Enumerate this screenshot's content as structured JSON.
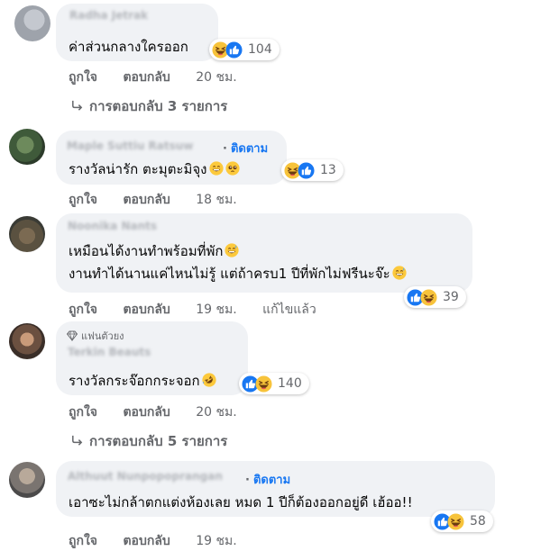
{
  "follow_label": "ติดตาม",
  "like_label": "ถูกใจ",
  "reply_label": "ตอบกลับ",
  "comments": [
    {
      "name": "Radha Jetrak",
      "text": "ค่าส่วนกลางใครออก",
      "reaction_count": "104",
      "time": "20 ชม.",
      "replies": "การตอบกลับ 3 รายการ"
    },
    {
      "name": "Maple Suttiu Ratsuw",
      "text": "รางวัลน่ารัก ตะมุตะมิจุง",
      "reaction_count": "13",
      "time": "18 ชม."
    },
    {
      "name": "Noonika Nants",
      "text_line1": "เหมือนได้งานทำพร้อมที่พัก",
      "text_line2": "งานทำได้นานแค่ไหนไม่รู้ แต่ถ้าครบ1 ปีที่พักไม่ฟรีนะจ๊ะ",
      "reaction_count": "39",
      "time": "19 ชม.",
      "edited": "แก้ไขแล้ว"
    },
    {
      "badge": "แฟนตัวยง",
      "name": "Terkin Beauts",
      "text": "รางวัลกระจ๊อกกระจอก",
      "reaction_count": "140",
      "time": "20 ชม.",
      "replies": "การตอบกลับ 5 รายการ"
    },
    {
      "name": "Althuut Nunpopoprangan",
      "text": "เอาซะไม่กล้าตกแต่งห้องเลย หมด 1 ปีก็ต้องออกอยู่ดี เฮ้ออ!!",
      "reaction_count": "58",
      "time": "19 ชม."
    }
  ]
}
